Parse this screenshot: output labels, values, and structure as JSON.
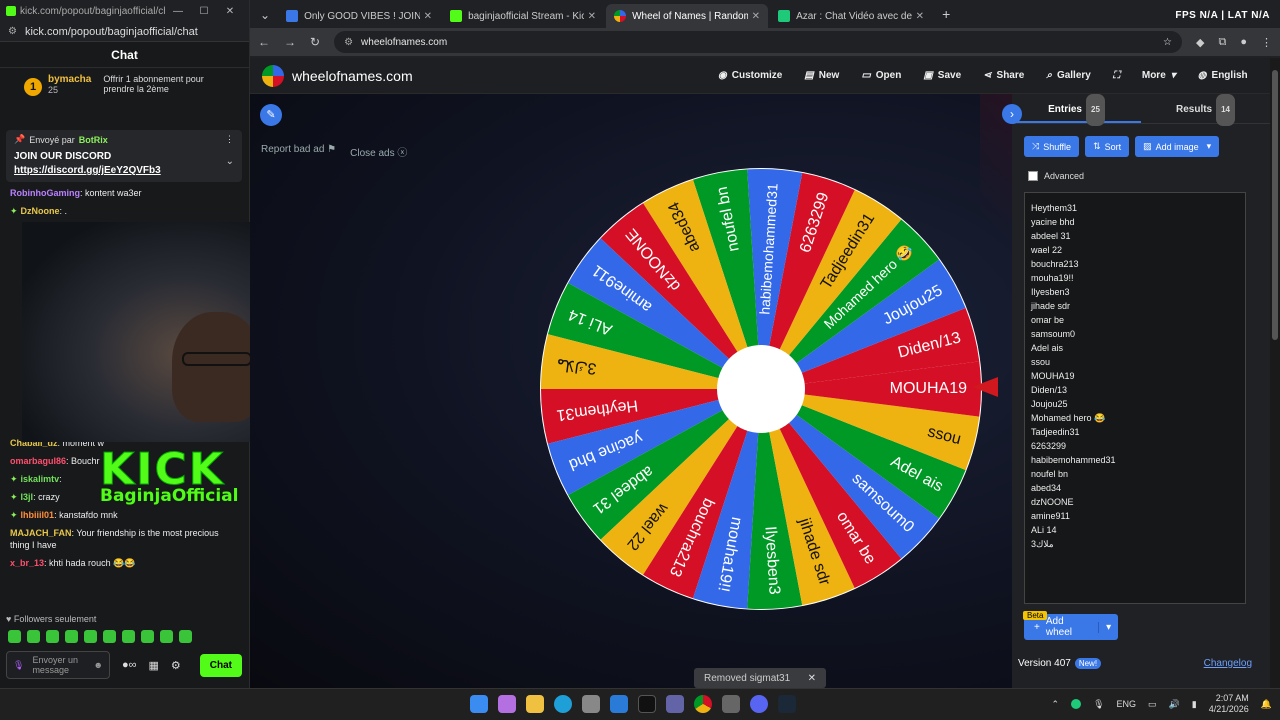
{
  "popout": {
    "title": "kick.com/popout/baginjaofficial/chat...",
    "url": "kick.com/popout/baginjaofficial/chat",
    "heading": "Chat",
    "sub_user": "bymacha",
    "sub_count": "25",
    "sub_level": "1",
    "sub_offer": "Offrir 1 abonnement pour prendre la 2ème",
    "pinned_label": "Envoyé par",
    "pinned_user": "BotRix",
    "pinned_text": "JOIN OUR DISCORD",
    "pinned_link": "https://discord.gg/jEeY2QVFb3",
    "messages": [
      {
        "user": "RobinhoGaming",
        "text": ": kontent wa3er"
      },
      {
        "user": "DzNoone",
        "text": ": ."
      },
      {
        "user": "Chaball_dz",
        "text": ": moment w"
      },
      {
        "user": "omarbagul86",
        "text": ": Bouchr"
      },
      {
        "user": "iskalimtv",
        "text": ":"
      },
      {
        "user": "I3jl",
        "text": ": crazy"
      },
      {
        "user": "lhbiiil01",
        "text": ": kanstafdo mnk"
      },
      {
        "user": "MAJACH_FAN",
        "text": ": Your friendship is the most precious thing I have"
      },
      {
        "user": "x_br_13",
        "text": ": khti hada rouch 😂😂"
      }
    ],
    "kick_logo": "KICK",
    "kick_channel": "BaginjaOfficial",
    "followers": "Followers seulement",
    "input_placeholder": "Envoyer un message",
    "chat_button": "Chat"
  },
  "browser": {
    "tabs": [
      {
        "title": "Only GOOD VIBES ! JOIN AND ...",
        "color": "#3b78e7"
      },
      {
        "title": "baginjaofficial Stream - Kick Da...",
        "color": "#53fc18"
      },
      {
        "title": "Wheel of Names | Random...",
        "color": "#d50f25"
      },
      {
        "title": "Azar : Chat Vidéo avec de n...",
        "color": "#1ec97a"
      }
    ],
    "fps_label": "FPS N/A  |  LAT N/A",
    "url": "wheelofnames.com"
  },
  "site": {
    "name": "wheelofnames.com",
    "menu": [
      "Customize",
      "New",
      "Open",
      "Save",
      "Share",
      "Gallery",
      "More",
      "English"
    ],
    "report_ad": "Report bad ad",
    "close_ads": "Close ads",
    "toast": "Removed sigmat31"
  },
  "wheel": {
    "colors": [
      "#d50f25",
      "#3369e8",
      "#009925",
      "#eeb211"
    ],
    "slices": [
      "Diden/13",
      "Joujou25",
      "Mohamed hero 😂",
      "Tadjeedin31",
      "6263299",
      "habibemohammed31",
      "noufel bn",
      "abed34",
      "dzNOONE",
      "amine911",
      "ALi 14",
      "3ملاك",
      "Heythem31",
      "yacine bhd",
      "abdeel 31",
      "wael 22",
      "bouchra213",
      "mouha19!!",
      "Ilyesben3",
      "jihade sdr",
      "omar be",
      "samsoum0",
      "Adel ais",
      "ssou",
      "MOUHA19"
    ]
  },
  "panel": {
    "tab_entries": "Entries",
    "entries_count": "25",
    "tab_results": "Results",
    "results_count": "14",
    "shuffle": "Shuffle",
    "sort": "Sort",
    "add_image": "Add image",
    "advanced": "Advanced",
    "entries": [
      "Heythem31",
      "yacine bhd",
      "abdeel 31",
      "wael 22",
      "bouchra213",
      "mouha19!!",
      "Ilyesben3",
      "jihade sdr",
      "omar be",
      "samsoum0",
      "Adel ais",
      "ssou",
      "MOUHA19",
      "Diden/13",
      "Joujou25",
      "Mohamed hero 😂",
      "Tadjeedin31",
      "6263299",
      "habibemohammed31",
      "noufel bn",
      "abed34",
      "dzNOONE",
      "amine911",
      "ALi 14",
      "3ملاك"
    ],
    "beta": "Beta",
    "add_wheel": "Add wheel",
    "version": "Version 407",
    "new_badge": "New!",
    "changelog": "Changelog"
  },
  "taskbar": {
    "lang": "ENG",
    "time": "2:07 AM",
    "date": "4/21/2026"
  }
}
